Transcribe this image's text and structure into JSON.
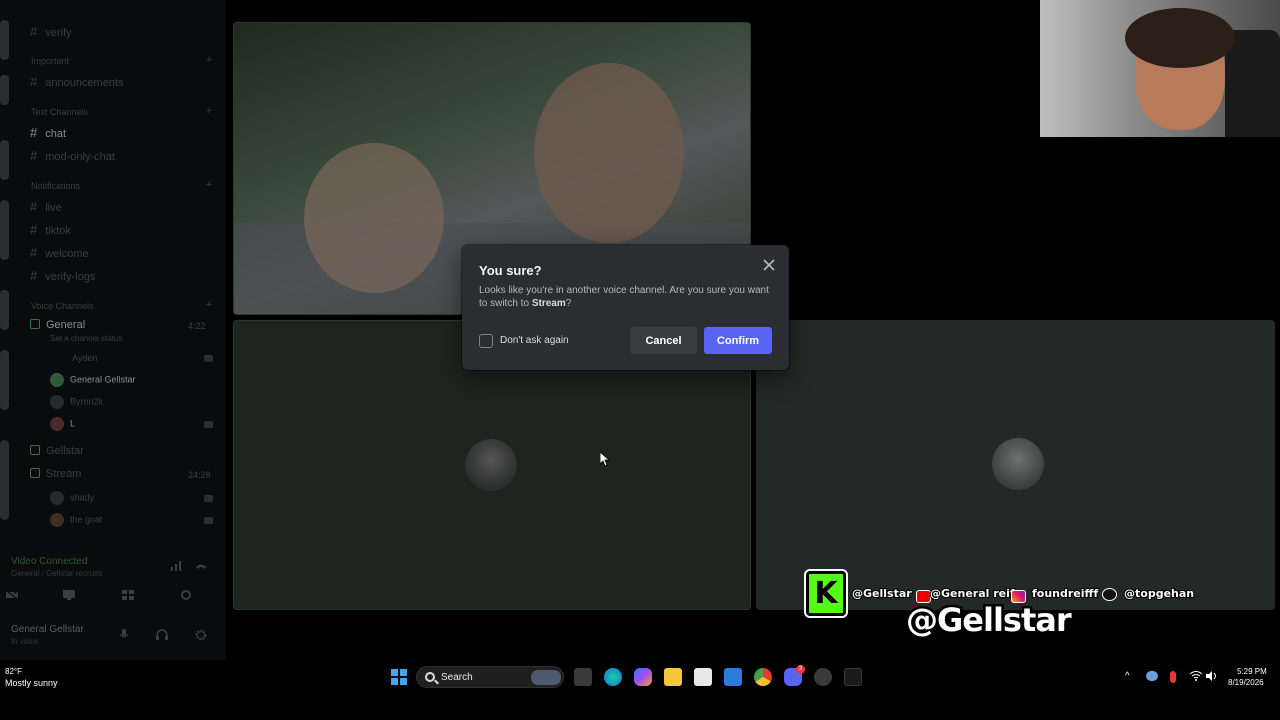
{
  "sidebar": {
    "channels_top": [
      {
        "label": "verify"
      }
    ],
    "important": {
      "label": "Important",
      "channels": [
        {
          "label": "announcements"
        }
      ]
    },
    "text_channels": {
      "label": "Text Channels",
      "channels": [
        {
          "label": "chat"
        },
        {
          "label": "mod-only-chat"
        }
      ]
    },
    "notifications": {
      "label": "Notifications",
      "channels": [
        {
          "label": "live"
        },
        {
          "label": "tiktok"
        },
        {
          "label": "welcome"
        },
        {
          "label": "verify-logs"
        }
      ]
    },
    "voice_channels": {
      "label": "Voice Channels",
      "general": {
        "label": "General",
        "time": "4:22",
        "status": "Set a channel status"
      },
      "general_users": [
        {
          "name": "Ayden"
        },
        {
          "name": "General Gellstar"
        },
        {
          "name": "Byron2k"
        },
        {
          "name": "L"
        }
      ],
      "gellstar": {
        "label": "Gellstar"
      },
      "stream": {
        "label": "Stream",
        "time": "24:28"
      },
      "stream_users": [
        {
          "name": "shady"
        },
        {
          "name": "the goat"
        }
      ]
    },
    "voice_connection": {
      "title": "Video Connected",
      "subtitle": "General / Gellstar recruits"
    },
    "user_panel": {
      "name": "General Gellstar",
      "status": "In voice"
    }
  },
  "modal": {
    "title": "You sure?",
    "body_prefix": "Looks like you're in another voice channel. Are you sure you want to switch to ",
    "channel": "Stream",
    "body_suffix": "?",
    "checkbox_label": "Don't ask again",
    "cancel_label": "Cancel",
    "confirm_label": "Confirm"
  },
  "overlay": {
    "kick_letter": "K",
    "socials": [
      {
        "platform": "kick",
        "handle": "@Gellstar"
      },
      {
        "platform": "youtube",
        "handle": "@General reif"
      },
      {
        "platform": "instagram",
        "handle": "foundreifff"
      },
      {
        "platform": "tiktok",
        "handle": "@topgehan"
      }
    ],
    "big_handle": "@Gellstar"
  },
  "taskbar": {
    "weather": {
      "temp": "82°F",
      "desc": "Mostly sunny"
    },
    "search_label": "Search",
    "clock": {
      "time": "5:29 PM",
      "date": "8/19/2026"
    },
    "discord_badge": "3"
  },
  "colors": {
    "accent": "#5865f2",
    "modal_bg": "#2b2d31",
    "kick_green": "#53fc18",
    "voice_green": "#2c5a36"
  }
}
